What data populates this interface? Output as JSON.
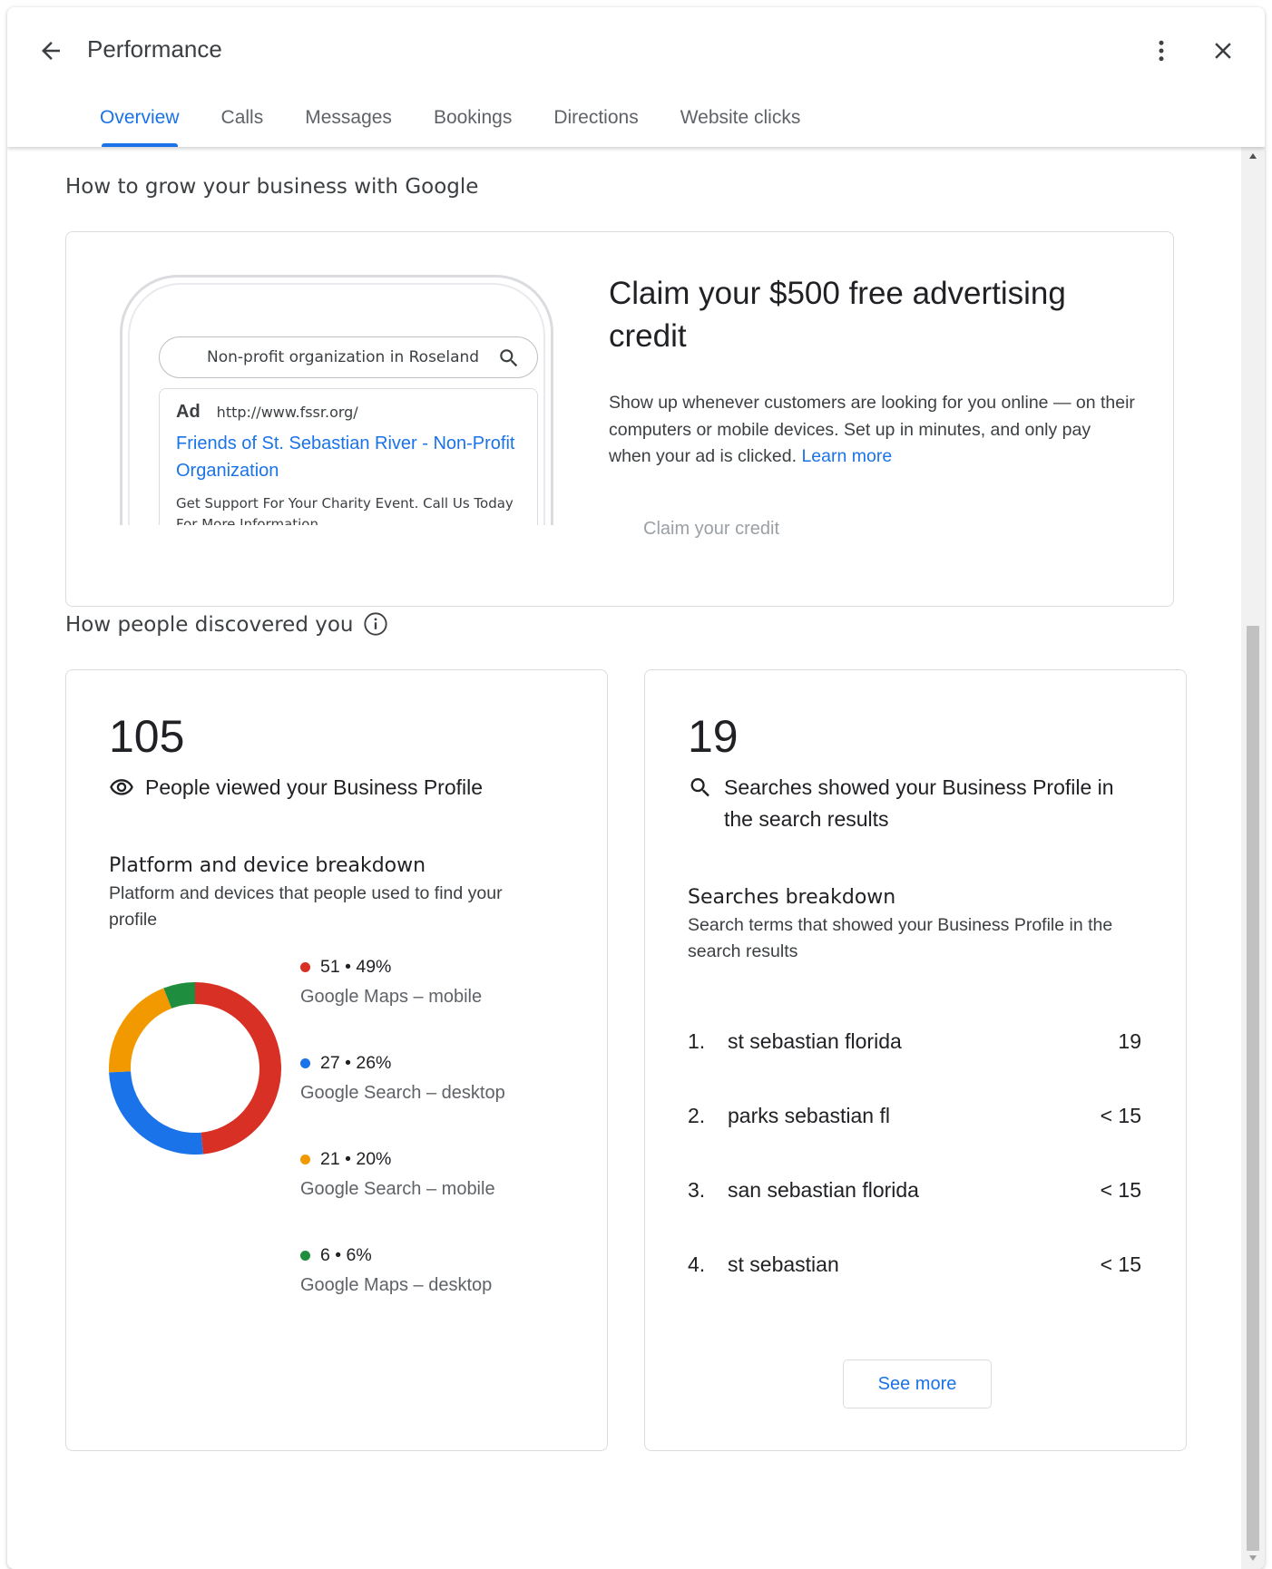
{
  "header": {
    "title": "Performance",
    "tabs": [
      {
        "label": "Overview",
        "active": true
      },
      {
        "label": "Calls"
      },
      {
        "label": "Messages"
      },
      {
        "label": "Bookings"
      },
      {
        "label": "Directions"
      },
      {
        "label": "Website clicks"
      }
    ]
  },
  "grow": {
    "section_title": "How to grow your business with Google",
    "phone": {
      "search_query": "Non-profit organization in Roseland",
      "ad_label": "Ad",
      "ad_url": "http://www.fssr.org/",
      "ad_title": "Friends of St. Sebastian River - Non-Profit Organization",
      "ad_description": "Get Support For Your Charity Event. Call Us Today For More Information."
    },
    "heading": "Claim your $500 free advertising credit",
    "body": "Show up whenever customers are looking for you online — on their computers or mobile devices. Set up in minutes, and only pay when your ad is clicked.",
    "learn_more": "Learn more",
    "claim_button": "Claim your credit"
  },
  "discovered": {
    "section_title": "How people discovered you",
    "views": {
      "count": "105",
      "label": "People viewed your Business Profile",
      "breakdown_title": "Platform and device breakdown",
      "breakdown_desc": "Platform and devices that people used to find your profile",
      "segments": [
        {
          "value": "51",
          "percent": "49%",
          "label": "Google Maps – mobile",
          "color": "#d93025",
          "fraction": 0.49
        },
        {
          "value": "27",
          "percent": "26%",
          "label": "Google Search – desktop",
          "color": "#1a73e8",
          "fraction": 0.26
        },
        {
          "value": "21",
          "percent": "20%",
          "label": "Google Search – mobile",
          "color": "#f29900",
          "fraction": 0.2
        },
        {
          "value": "6",
          "percent": "6%",
          "label": "Google Maps – desktop",
          "color": "#1e8e3e",
          "fraction": 0.06
        }
      ]
    },
    "searches": {
      "count": "19",
      "label": "Searches showed your Business Profile in the search results",
      "breakdown_title": "Searches breakdown",
      "breakdown_desc": "Search terms that showed your Business Profile in the search results",
      "terms": [
        {
          "rank": "1.",
          "term": "st sebastian florida",
          "count": "19"
        },
        {
          "rank": "2.",
          "term": "parks sebastian fl",
          "count": "< 15"
        },
        {
          "rank": "3.",
          "term": "san sebastian florida",
          "count": "< 15"
        },
        {
          "rank": "4.",
          "term": "st sebastian",
          "count": "< 15"
        }
      ],
      "see_more": "See more"
    }
  }
}
